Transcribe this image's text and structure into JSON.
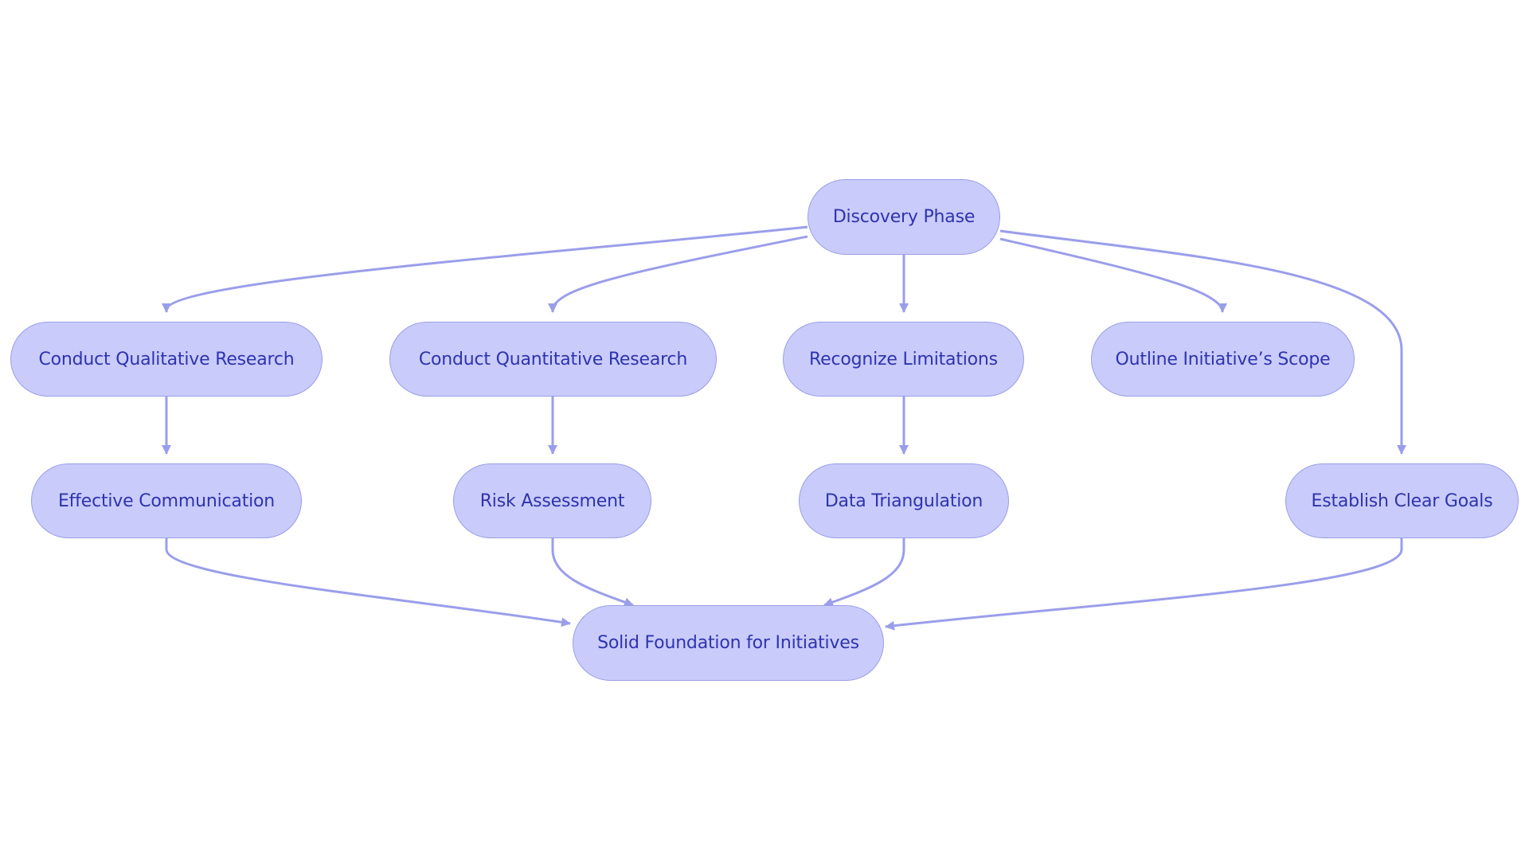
{
  "diagram": {
    "type": "flowchart",
    "colors": {
      "node_fill": "#c9cbfb",
      "node_border": "#9b9fe6",
      "text": "#2e34ae",
      "edge": "#9a9eea"
    },
    "nodes": [
      {
        "id": "discovery",
        "label": "Discovery Phase"
      },
      {
        "id": "qual",
        "label": "Conduct Qualitative Research"
      },
      {
        "id": "quant",
        "label": "Conduct Quantitative Research"
      },
      {
        "id": "limits",
        "label": "Recognize Limitations"
      },
      {
        "id": "scope",
        "label": "Outline Initiative’s Scope"
      },
      {
        "id": "comm",
        "label": "Effective Communication"
      },
      {
        "id": "risk",
        "label": "Risk Assessment"
      },
      {
        "id": "tri",
        "label": "Data Triangulation"
      },
      {
        "id": "goals",
        "label": "Establish Clear Goals"
      },
      {
        "id": "foundation",
        "label": "Solid Foundation for Initiatives"
      }
    ],
    "edges": [
      {
        "from": "discovery",
        "to": "qual"
      },
      {
        "from": "discovery",
        "to": "quant"
      },
      {
        "from": "discovery",
        "to": "limits"
      },
      {
        "from": "discovery",
        "to": "scope"
      },
      {
        "from": "discovery",
        "to": "goals"
      },
      {
        "from": "qual",
        "to": "comm"
      },
      {
        "from": "quant",
        "to": "risk"
      },
      {
        "from": "limits",
        "to": "tri"
      },
      {
        "from": "comm",
        "to": "foundation"
      },
      {
        "from": "risk",
        "to": "foundation"
      },
      {
        "from": "tri",
        "to": "foundation"
      },
      {
        "from": "goals",
        "to": "foundation"
      }
    ]
  }
}
